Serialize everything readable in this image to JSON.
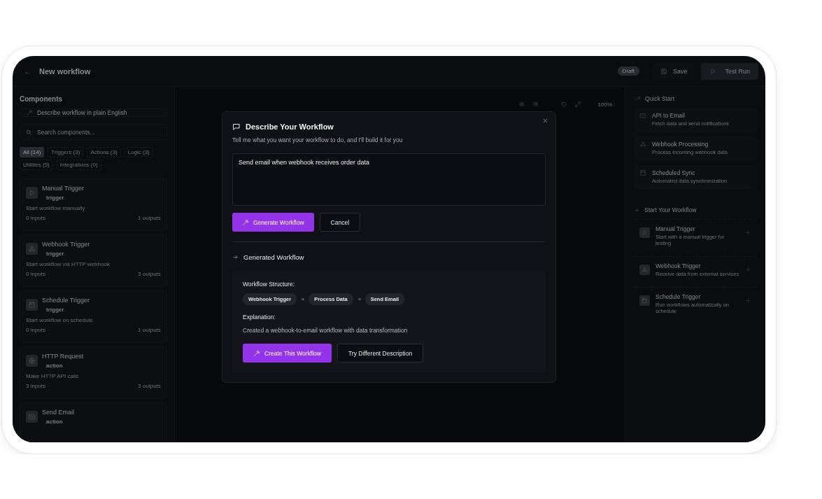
{
  "top_bar": {
    "back": "←",
    "title": "New workflow",
    "status_badge": "Draft",
    "save_button": "Save",
    "test_run_button": "Test Run"
  },
  "components_panel": {
    "title": "Components",
    "describe_button": "Describe workflow in plain English",
    "search": {
      "placeholder": "Search components..."
    },
    "filters": [
      {
        "label": "All (14)",
        "selected": true
      },
      {
        "label": "Triggers (3)",
        "selected": false
      },
      {
        "label": "Actions (3)",
        "selected": false
      },
      {
        "label": "Logic (3)",
        "selected": false
      },
      {
        "label": "Utilities (5)",
        "selected": false
      },
      {
        "label": "Integrations (0)",
        "selected": false
      }
    ],
    "items": [
      {
        "name": "Manual Trigger",
        "type": "trigger",
        "description": "Start workflow manually",
        "inputs": "0 inputs",
        "outputs": "1 outputs"
      },
      {
        "name": "Webhook Trigger",
        "type": "trigger",
        "description": "Start workflow via HTTP webhook",
        "inputs": "0 inputs",
        "outputs": "3 outputs"
      },
      {
        "name": "Schedule Trigger",
        "type": "trigger",
        "description": "Start workflow on schedule",
        "inputs": "0 inputs",
        "outputs": "1 outputs"
      },
      {
        "name": "HTTP Request",
        "type": "action",
        "description": "Make HTTP API calls",
        "inputs": "3 inputs",
        "outputs": "3 outputs"
      },
      {
        "name": "Send Email",
        "type": "action"
      }
    ]
  },
  "canvas": {
    "zoom_level": "100%"
  },
  "quick_start": {
    "title": "Quick Start",
    "templates": [
      {
        "name": "API to Email",
        "description": "Fetch data and send notifications"
      },
      {
        "name": "Webhook Processing",
        "description": "Process incoming webhook data"
      },
      {
        "name": "Scheduled Sync",
        "description": "Automated data synchronization"
      }
    ],
    "start_title": "Start Your Workflow",
    "triggers": [
      {
        "name": "Manual Trigger",
        "description": "Start with a manual trigger for testing"
      },
      {
        "name": "Webhook Trigger",
        "description": "Receive data from external services"
      },
      {
        "name": "Schedule Trigger",
        "description": "Run workflows automatically on schedule"
      }
    ]
  },
  "dialog": {
    "title": "Describe Your Workflow",
    "subtitle": "Tell me what you want your workflow to do, and I'll build it for you",
    "description_value": "Send email when webhook receives order data",
    "generate_button": "Generate Workflow",
    "cancel_button": "Cancel",
    "result": {
      "title": "Generated Workflow",
      "structure_label": "Workflow Structure:",
      "steps": [
        "Webhook Trigger",
        "Process Data",
        "Send Email"
      ],
      "explanation_label": "Explanation:",
      "explanation": "Created a webhook-to-email workflow with data transformation",
      "create_button": "Create This Workflow",
      "retry_button": "Try Different Description"
    }
  }
}
